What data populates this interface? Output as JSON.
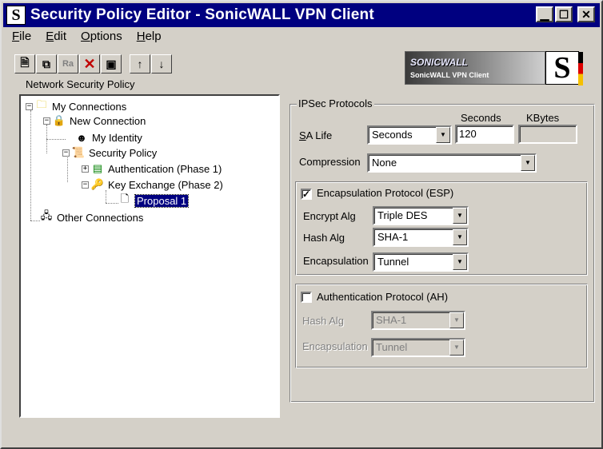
{
  "window": {
    "title": "Security Policy Editor - SonicWALL VPN Client",
    "logo": "S"
  },
  "menu": [
    "File",
    "Edit",
    "Options",
    "Help"
  ],
  "toolbar": {
    "icons": [
      "new-icon",
      "copy-icon",
      "rename-icon",
      "delete-icon",
      "save-icon",
      "move-up-icon",
      "move-down-icon"
    ],
    "rename_text": "Ra"
  },
  "brand": {
    "name": "SONICWALL",
    "product": "SonicWALL VPN Client",
    "logo": "S"
  },
  "tree": {
    "title": "Network Security Policy",
    "my_connections": "My Connections",
    "new_connection": "New Connection",
    "my_identity": "My Identity",
    "security_policy": "Security Policy",
    "authentication": "Authentication (Phase 1)",
    "key_exchange": "Key Exchange (Phase 2)",
    "proposal": "Proposal 1",
    "other_connections": "Other Connections"
  },
  "ipsec": {
    "title": "IPSec Protocols",
    "seconds_header": "Seconds",
    "kbytes_header": "KBytes",
    "sa_life_label": "SA Life",
    "sa_life_value": "Seconds",
    "seconds_value": "120",
    "kbytes_value": "",
    "compression_label": "Compression",
    "compression_value": "None",
    "esp": {
      "label": "Encapsulation Protocol (ESP)",
      "checked": true,
      "encrypt_label": "Encrypt Alg",
      "encrypt_value": "Triple DES",
      "hash_label": "Hash Alg",
      "hash_value": "SHA-1",
      "encap_label": "Encapsulation",
      "encap_value": "Tunnel"
    },
    "ah": {
      "label": "Authentication Protocol (AH)",
      "checked": false,
      "hash_label": "Hash Alg",
      "hash_value": "SHA-1",
      "encap_label": "Encapsulation",
      "encap_value": "Tunnel"
    }
  }
}
